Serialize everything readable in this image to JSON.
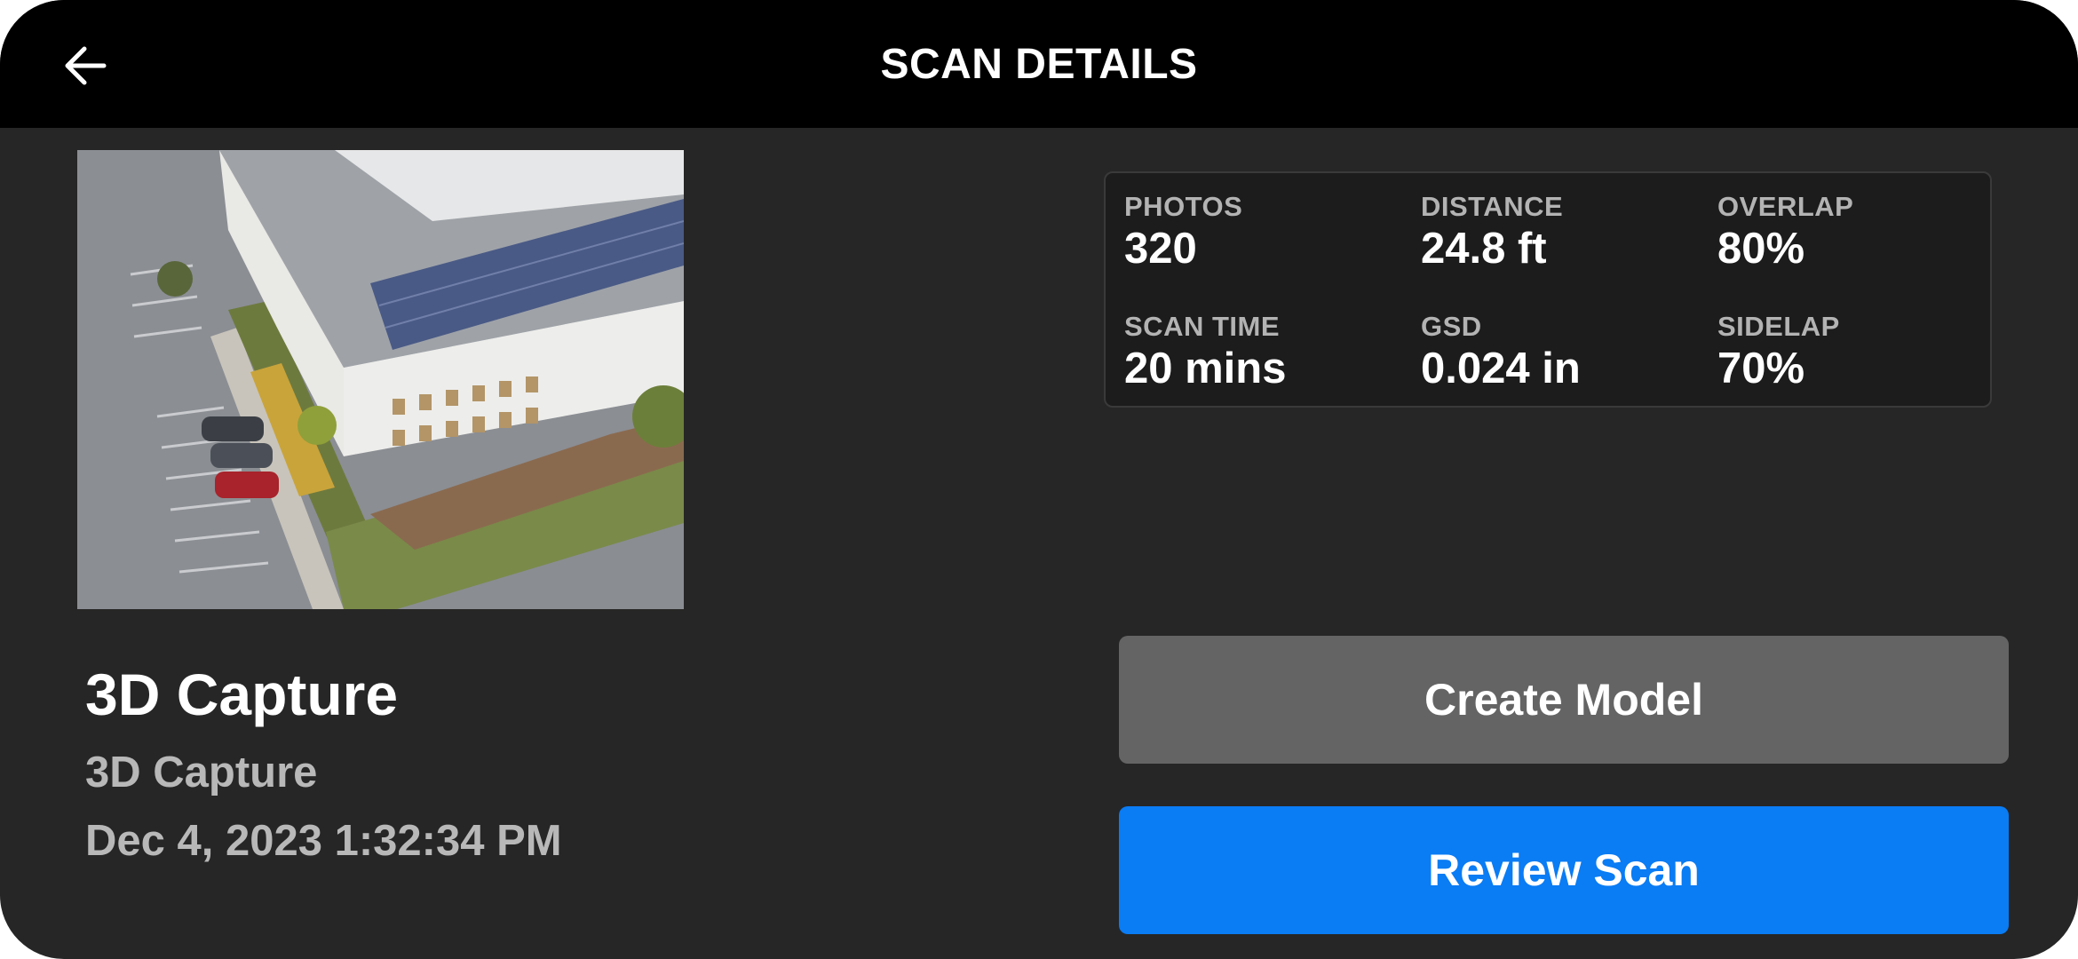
{
  "header": {
    "title": "SCAN DETAILS",
    "back_icon": "arrow-left-icon"
  },
  "scan": {
    "name": "3D Capture",
    "type": "3D Capture",
    "date": "Dec 4, 2023 1:32:34 PM"
  },
  "stats": [
    {
      "label": "PHOTOS",
      "value": "320"
    },
    {
      "label": "DISTANCE",
      "value": "24.8 ft"
    },
    {
      "label": "OVERLAP",
      "value": "80%"
    },
    {
      "label": "SCAN TIME",
      "value": "20 mins"
    },
    {
      "label": "GSD",
      "value": "0.024 in"
    },
    {
      "label": "SIDELAP",
      "value": "70%"
    }
  ],
  "buttons": {
    "create_model": "Create Model",
    "review_scan": "Review Scan"
  },
  "colors": {
    "background": "#262626",
    "header": "#000000",
    "primary_button": "#0a7cf4",
    "secondary_button": "#646464",
    "stats_panel": "#1c1c1c"
  }
}
